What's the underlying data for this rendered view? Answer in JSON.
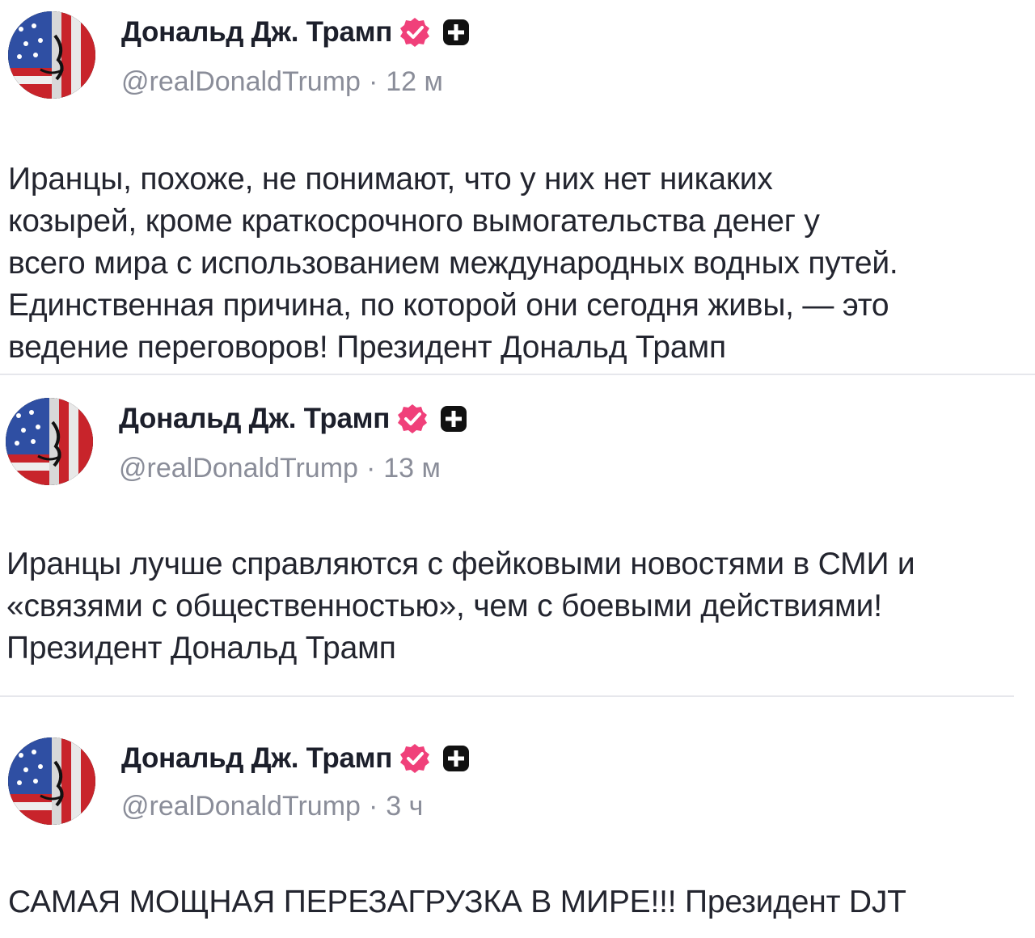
{
  "colors": {
    "verified_badge": "#f0407a",
    "plus_badge": "#111111",
    "muted_text": "#8a8d99",
    "divider": "#e6e7ec"
  },
  "posts": [
    {
      "author_name": "Дональд Дж. Трамп",
      "handle": "@realDonaldTrump",
      "separator": "·",
      "time": "12 м",
      "verified_icon": "verified-icon",
      "badge_icon": "plus-badge-icon",
      "text_lines": [
        "Иранцы, похоже, не понимают, что у них нет никаких",
        "козырей, кроме краткосрочного вымогательства денег у",
        "всего мира с использованием международных водных путей.",
        "Единственная причина, по которой они сегодня живы, — это",
        "ведение переговоров! Президент Дональд Трамп"
      ]
    },
    {
      "author_name": "Дональд Дж. Трамп",
      "handle": "@realDonaldTrump",
      "separator": "·",
      "time": "13 м",
      "verified_icon": "verified-icon",
      "badge_icon": "plus-badge-icon",
      "text_lines": [
        "Иранцы лучше справляются с фейковыми новостями в СМИ и",
        "«связями с общественностью», чем с боевыми действиями!",
        "Президент Дональд Трамп"
      ]
    },
    {
      "author_name": "Дональд Дж. Трамп",
      "handle": "@realDonaldTrump",
      "separator": "·",
      "time": "3 ч",
      "verified_icon": "verified-icon",
      "badge_icon": "plus-badge-icon",
      "text_lines": [
        "САМАЯ МОЩНАЯ ПЕРЕЗАГРУЗКА В МИРЕ!!! Президент DJT"
      ]
    }
  ]
}
